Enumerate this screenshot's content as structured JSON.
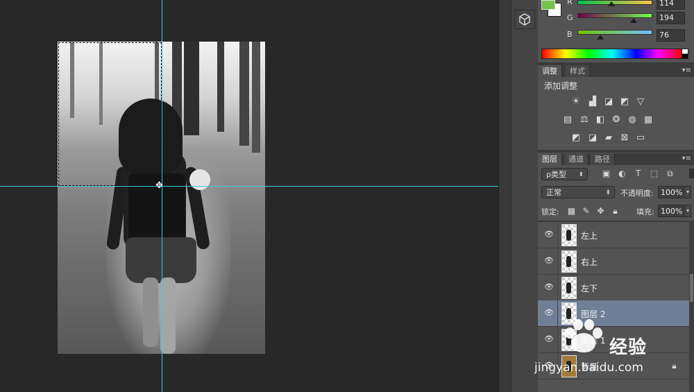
{
  "color_panel": {
    "foreground_color": "#72c24c",
    "background_color": "#ffffff",
    "channels": [
      {
        "label": "R",
        "value": "114"
      },
      {
        "label": "G",
        "value": "194"
      },
      {
        "label": "B",
        "value": "76"
      }
    ]
  },
  "adjustments_panel": {
    "tabs": [
      "调整",
      "样式"
    ],
    "title": "添加调整",
    "icons_row1": [
      "☀",
      "▟",
      "◪",
      "◩",
      "▽"
    ],
    "icons_row2": [
      "▤",
      "⚖",
      "◧",
      "❂",
      "◍",
      "▦"
    ],
    "icons_row3": [
      "◩",
      "◪",
      "▰",
      "⊠",
      "▭"
    ]
  },
  "layers_panel": {
    "tabs": [
      "图层",
      "通道",
      "路径"
    ],
    "filter_kind": "ρ类型",
    "blend_mode": "正常",
    "opacity_label": "不透明度:",
    "opacity_value": "100%",
    "lock_label": "锁定:",
    "fill_label": "填充:",
    "fill_value": "100%",
    "layers": [
      {
        "name": "左上",
        "selected": false
      },
      {
        "name": "右上",
        "selected": false
      },
      {
        "name": "左下",
        "selected": false
      },
      {
        "name": "图层 2",
        "selected": true
      },
      {
        "name": "图层 1",
        "selected": false
      },
      {
        "name": "背景",
        "selected": false
      }
    ]
  },
  "watermark": {
    "brand": "经验",
    "site": "jingyan.baidu.com"
  }
}
